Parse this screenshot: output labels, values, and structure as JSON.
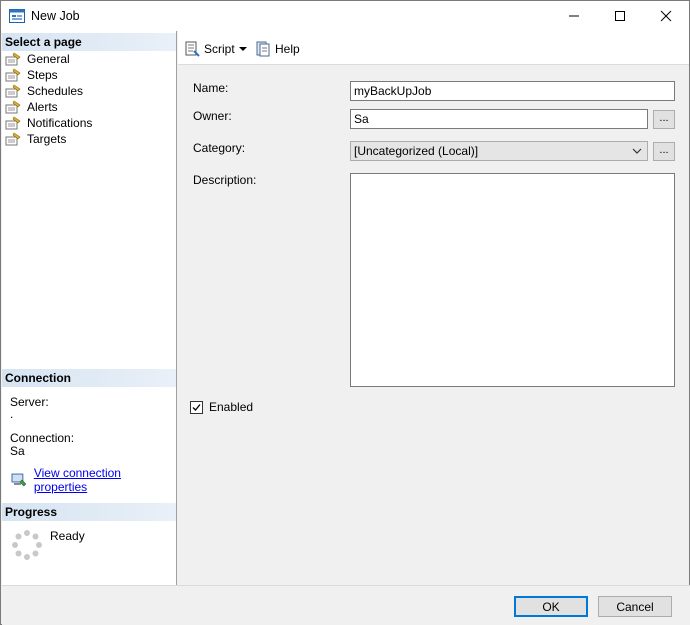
{
  "window": {
    "title": "New Job"
  },
  "left_panel": {
    "select_page_header": "Select a page",
    "pages": [
      {
        "label": "General"
      },
      {
        "label": "Steps"
      },
      {
        "label": "Schedules"
      },
      {
        "label": "Alerts"
      },
      {
        "label": "Notifications"
      },
      {
        "label": "Targets"
      }
    ],
    "connection_header": "Connection",
    "server_label": "Server:",
    "server_value": ".",
    "connection_label": "Connection:",
    "connection_value": "Sa",
    "view_connection_link": "View connection properties",
    "progress_header": "Progress",
    "progress_status": "Ready"
  },
  "toolbar": {
    "script_label": "Script",
    "help_label": "Help"
  },
  "form": {
    "name_label": "Name:",
    "name_value": "myBackUpJob",
    "owner_label": "Owner:",
    "owner_value": "Sa",
    "category_label": "Category:",
    "category_value": "[Uncategorized (Local)]",
    "description_label": "Description:",
    "description_value": "",
    "browse_label": "...",
    "enabled_label": "Enabled",
    "enabled_checked": true
  },
  "buttons": {
    "ok_label": "OK",
    "cancel_label": "Cancel"
  }
}
